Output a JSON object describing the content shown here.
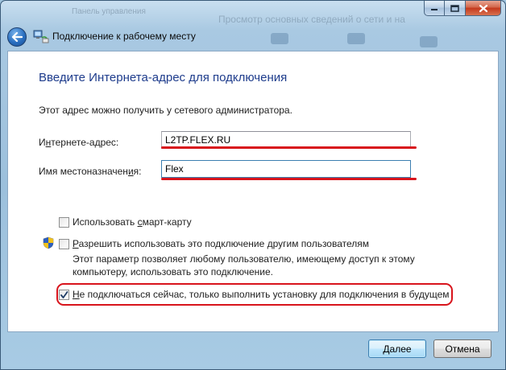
{
  "window": {
    "title": "Подключение к рабочему месту",
    "background_text_1": "Панель управления",
    "background_text_2": "Просмотр основных сведений о сети и на"
  },
  "page": {
    "heading": "Введите Интернета-адрес для подключения",
    "description": "Этот адрес можно получить у сетевого администратора.",
    "address_label_pre": "И",
    "address_label_ul": "н",
    "address_label_post": "тернете-адрес:",
    "address_value": "L2TP.FLEX.RU",
    "dest_label_pre": "Имя местоназначен",
    "dest_label_ul": "и",
    "dest_label_post": "я:",
    "dest_value": "Flex",
    "smartcard_pre": "Использовать ",
    "smartcard_ul": "с",
    "smartcard_post": "март-карту",
    "allow_pre": "",
    "allow_ul": "Р",
    "allow_post": "азрешить использовать это подключение другим пользователям",
    "allow_note": "Этот параметр позволяет любому пользователю, имеющему доступ к этому компьютеру, использовать это подключение.",
    "dont_connect_pre": "",
    "dont_connect_ul": "Н",
    "dont_connect_post": "е подключаться сейчас, только выполнить установку для подключения в будущем"
  },
  "buttons": {
    "next_pre": "",
    "next_ul": "Д",
    "next_post": "алее",
    "cancel": "Отмена"
  },
  "state": {
    "smartcard_checked": false,
    "allow_others_checked": false,
    "dont_connect_checked": true
  },
  "colors": {
    "heading": "#1e3c8c",
    "highlight_red": "#d8141c",
    "frame": "#9fc3dd"
  }
}
